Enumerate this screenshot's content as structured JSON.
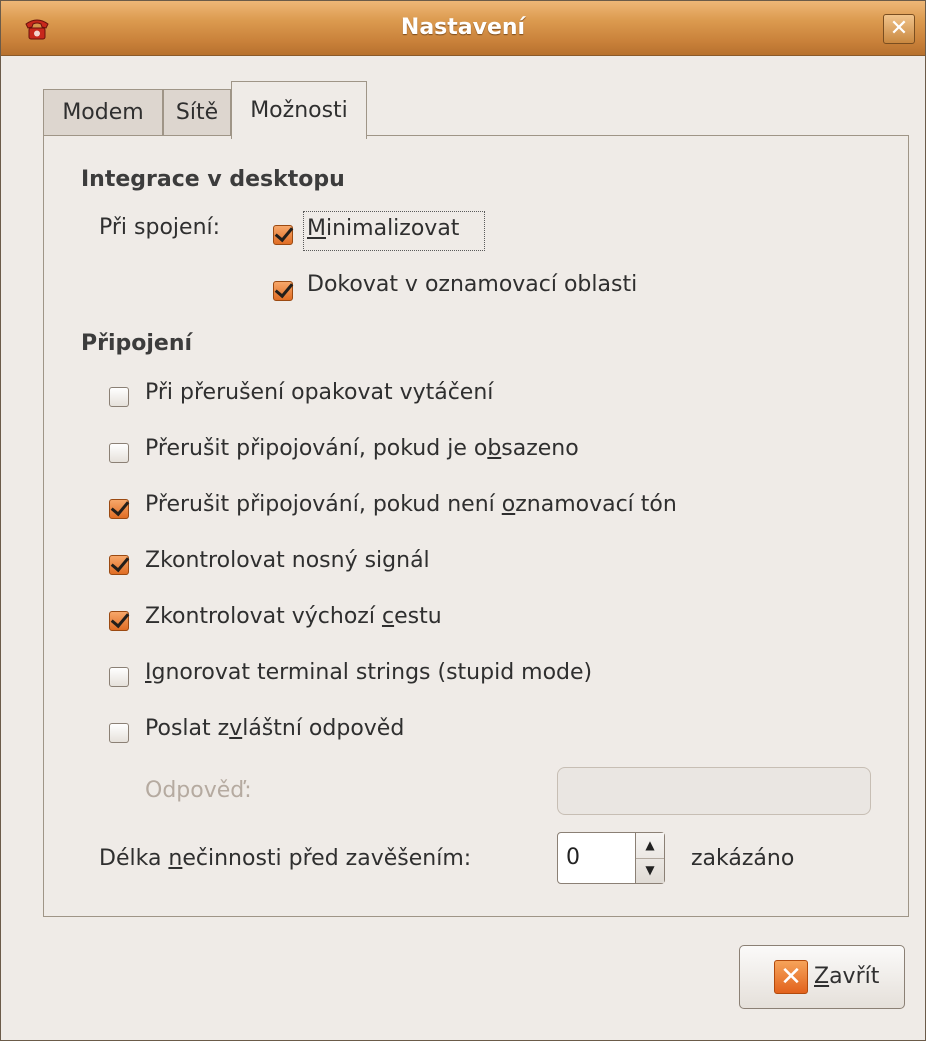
{
  "window": {
    "title": "Nastavení",
    "close_glyph": "✕",
    "app_icon": "telephone-icon"
  },
  "tabs": [
    {
      "label": "Modem"
    },
    {
      "label": "Sítě"
    },
    {
      "label": "Možnosti",
      "active": true
    }
  ],
  "desktop": {
    "heading": "Integrace v desktopu",
    "on_connect_label": "Při spojení:",
    "minimize": {
      "pre": "",
      "u": "M",
      "post": "inimalizovat",
      "checked": true
    },
    "dock": {
      "label": "Dokovat v oznamovací oblasti",
      "checked": true
    }
  },
  "connection": {
    "heading": "Připojení",
    "options": [
      {
        "pre": "Při přerušení opakovat vytáčení",
        "u": "",
        "post": "",
        "checked": false
      },
      {
        "pre": "Přerušit připojování, pokud je o",
        "u": "b",
        "post": "sazeno",
        "checked": false
      },
      {
        "pre": "Přerušit připojování, pokud není ",
        "u": "o",
        "post": "znamovací tón",
        "checked": true
      },
      {
        "pre": "Zkontrolovat nosný signál",
        "u": "",
        "post": "",
        "checked": true
      },
      {
        "pre": "Zkontrolovat výchozí ",
        "u": "c",
        "post": "estu",
        "checked": true
      },
      {
        "pre": "",
        "u": "I",
        "post": "gnorovat terminal strings (stupid mode)",
        "checked": false
      },
      {
        "pre": "Poslat z",
        "u": "v",
        "post": "láštní odpověd",
        "checked": false
      }
    ],
    "answer_label": "Odpověď:",
    "answer_value": "",
    "idle": {
      "pre": "Délka ",
      "u": "n",
      "post": "ečinnosti před zavěšením:",
      "value": "0",
      "suffix": "zakázáno"
    }
  },
  "buttons": {
    "close": {
      "u": "Z",
      "post": "avřít"
    }
  },
  "colors": {
    "accent": "#e06d24",
    "titlebar": "#d4914a",
    "window_bg": "#efebe7"
  }
}
